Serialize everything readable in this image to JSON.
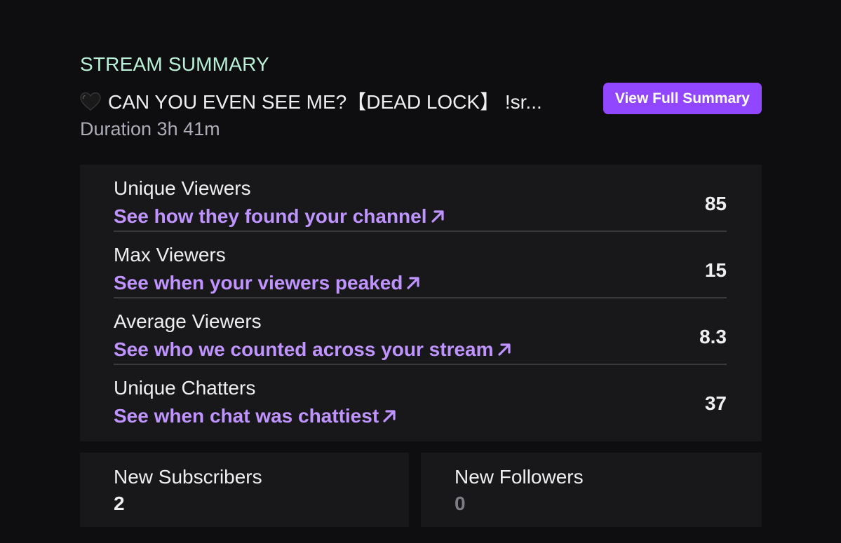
{
  "summary": {
    "eyebrow": "STREAM SUMMARY",
    "stream_title": "CAN YOU EVEN SEE ME?【DEAD LOCK】 !sr...",
    "title_icon": "black-heart-icon",
    "duration": "Duration 3h 41m",
    "view_button_label": "View Full Summary"
  },
  "stats": [
    {
      "label": "Unique Viewers",
      "link": "See how they found your channel",
      "value": "85"
    },
    {
      "label": "Max Viewers",
      "link": "See when your viewers peaked",
      "value": "15"
    },
    {
      "label": "Average Viewers",
      "link": "See who we counted across your stream",
      "value": "8.3"
    },
    {
      "label": "Unique Chatters",
      "link": "See when chat was chattiest",
      "value": "37"
    }
  ],
  "cards": {
    "subscribers": {
      "label": "New Subscribers",
      "value": "2"
    },
    "followers": {
      "label": "New Followers",
      "value": "0"
    }
  },
  "colors": {
    "background": "#0e0e10",
    "card": "#18181b",
    "accent": "#9147ff",
    "link": "#bf94ff",
    "eyebrow": "#b8f0d8",
    "muted": "#adadb8"
  }
}
